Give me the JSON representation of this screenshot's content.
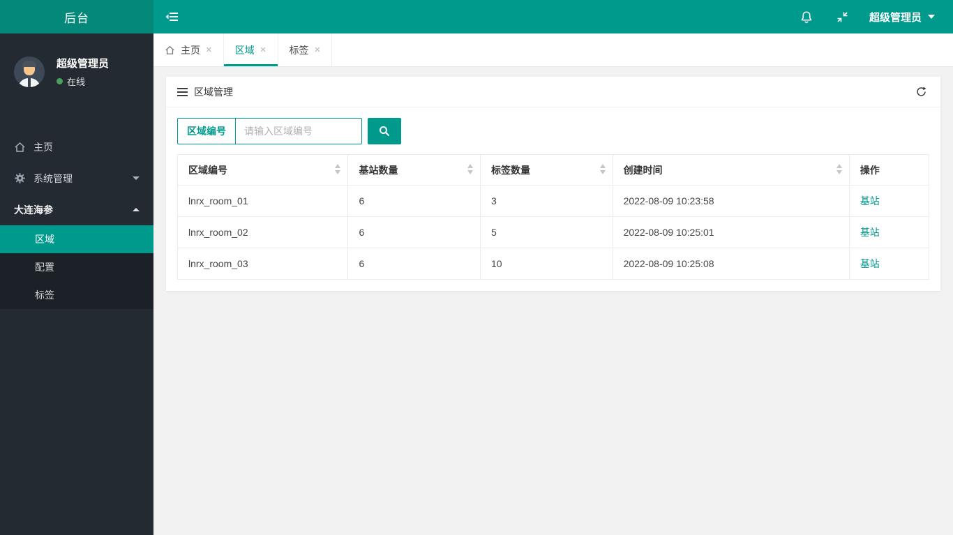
{
  "topbar": {
    "brand": "后台",
    "user_menu": "超级管理员"
  },
  "sidebar": {
    "user": {
      "name": "超级管理员",
      "status": "在线"
    },
    "items": [
      {
        "label": "主页"
      },
      {
        "label": "系统管理"
      },
      {
        "label": "大连海参"
      }
    ],
    "submenu": [
      {
        "label": "区域",
        "active": true
      },
      {
        "label": "配置",
        "active": false
      },
      {
        "label": "标签",
        "active": false
      }
    ]
  },
  "tabs": [
    {
      "label": "主页",
      "active": false
    },
    {
      "label": "区域",
      "active": true
    },
    {
      "label": "标签",
      "active": false
    }
  ],
  "panel": {
    "title": "区域管理"
  },
  "search": {
    "field_label": "区域编号",
    "placeholder": "请输入区域编号"
  },
  "table": {
    "columns": [
      "区域编号",
      "基站数量",
      "标签数量",
      "创建时间",
      "操作"
    ],
    "rows": [
      {
        "region_id": "lnrx_room_01",
        "station_count": "6",
        "tag_count": "3",
        "created_at": "2022-08-09 10:23:58",
        "action": "基站"
      },
      {
        "region_id": "lnrx_room_02",
        "station_count": "6",
        "tag_count": "5",
        "created_at": "2022-08-09 10:25:01",
        "action": "基站"
      },
      {
        "region_id": "lnrx_room_03",
        "station_count": "6",
        "tag_count": "10",
        "created_at": "2022-08-09 10:25:08",
        "action": "基站"
      }
    ]
  },
  "icons": {
    "close_glyph": "×",
    "collapse": "sidebar-collapse-icon",
    "bell": "notification-bell-icon",
    "screen": "fullscreen-toggle-icon",
    "home": "home-icon",
    "gear": "settings-gear-icon",
    "refresh": "refresh-icon",
    "search": "magnifier-icon"
  },
  "colors": {
    "accent": "#009a8d",
    "brand_bg": "#04887a",
    "sidebar_bg": "#242a31",
    "submenu_bg": "#1b2126",
    "online_green": "#4aa15f",
    "link": "#009a8d"
  }
}
